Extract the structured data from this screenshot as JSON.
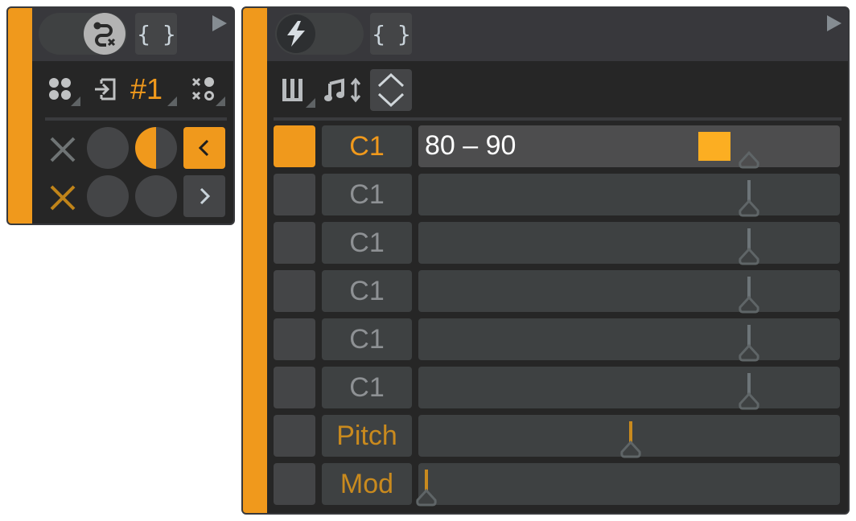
{
  "left_panel": {
    "header": {
      "toggle_icon": "route-disconnect-icon",
      "braces_label": "{ }",
      "expand_icon": "play-triangle-icon"
    },
    "toolbar": {
      "items": [
        {
          "icon": "four-dots-icon",
          "has_menu": true
        },
        {
          "icon": "enter-arrow-icon",
          "has_menu": false
        },
        {
          "label": "#1",
          "has_menu": true
        },
        {
          "icon": "cross-dots-icon",
          "has_menu": true
        }
      ]
    },
    "grid": {
      "row1": [
        "x-icon-gray",
        "circle-empty",
        "circle-half-filled",
        "chevron-left-button"
      ],
      "row2": [
        "x-icon-orange",
        "circle-empty",
        "circle-empty",
        "chevron-right-button"
      ],
      "prev_label": "<",
      "next_label": ">"
    }
  },
  "right_panel": {
    "header": {
      "toggle_icon": "lightning-icon",
      "braces_label": "{ }",
      "expand_icon": "play-triangle-icon"
    },
    "toolbar": {
      "items": [
        {
          "icon": "piano-keys-icon",
          "has_menu": true
        },
        {
          "icon": "note-updown-icon",
          "has_menu": false
        },
        {
          "icon": "up-down-chevrons-icon",
          "has_menu": false
        }
      ]
    },
    "rows": [
      {
        "name": "C1",
        "value_text": "80 – 90",
        "active": true,
        "handle_pos": 0.78,
        "marker_pos": 0.665
      },
      {
        "name": "C1",
        "value_text": "",
        "active": false,
        "handle_pos": 0.78
      },
      {
        "name": "C1",
        "value_text": "",
        "active": false,
        "handle_pos": 0.78
      },
      {
        "name": "C1",
        "value_text": "",
        "active": false,
        "handle_pos": 0.78
      },
      {
        "name": "C1",
        "value_text": "",
        "active": false,
        "handle_pos": 0.78
      },
      {
        "name": "C1",
        "value_text": "",
        "active": false,
        "handle_pos": 0.78
      },
      {
        "name": "Pitch",
        "value_text": "",
        "active": false,
        "handle_pos": 0.5,
        "accent": true
      },
      {
        "name": "Mod",
        "value_text": "",
        "active": false,
        "handle_pos": 0.0,
        "accent": true
      }
    ]
  },
  "colors": {
    "accent": "#f0991c",
    "accent_dim": "#c98a1e",
    "marker": "#fcae22",
    "panel_bg": "#262626",
    "header_bg": "#38383c"
  }
}
